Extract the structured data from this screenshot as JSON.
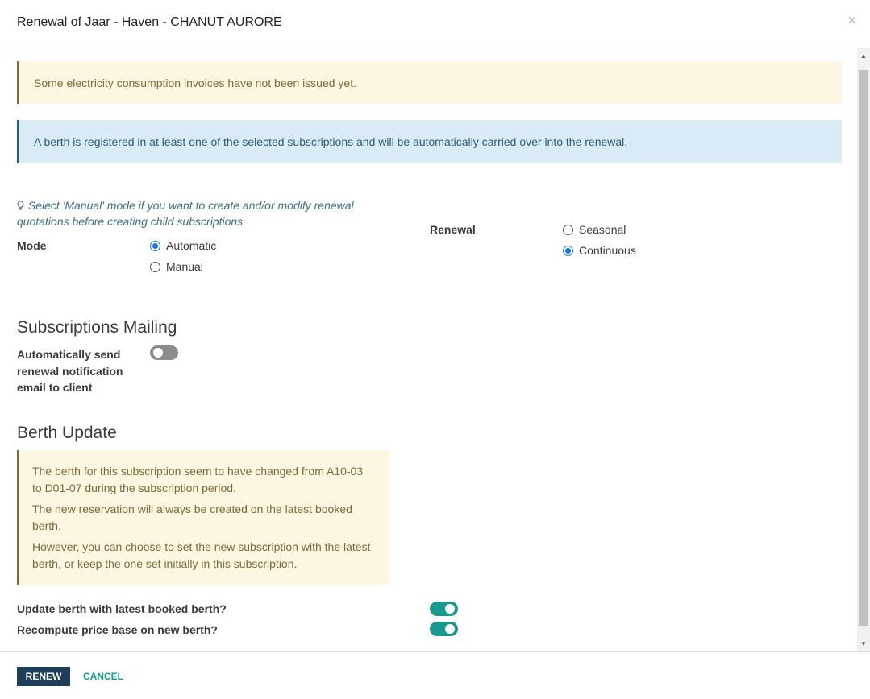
{
  "dialog": {
    "title": "Renewal of Jaar - Haven - CHANUT AURORE",
    "close_glyph": "×"
  },
  "alerts": {
    "warning": "Some electricity consumption invoices have not been issued yet.",
    "info": "A berth is registered in at least one of the selected subscriptions and will be automatically carried over into the renewal."
  },
  "hint": {
    "icon": "lightbulb-icon",
    "text": "Select 'Manual' mode if you want to create and/or modify renewal quotations before creating child subscriptions."
  },
  "mode": {
    "label": "Mode",
    "options": [
      {
        "label": "Automatic",
        "checked": true
      },
      {
        "label": "Manual",
        "checked": false
      }
    ]
  },
  "renewal": {
    "label": "Renewal",
    "options": [
      {
        "label": "Seasonal",
        "checked": false
      },
      {
        "label": "Continuous",
        "checked": true
      }
    ]
  },
  "mailing": {
    "title": "Subscriptions Mailing",
    "auto_send_label": "Automatically send renewal notification email to client",
    "auto_send_enabled": false
  },
  "berth_update": {
    "title": "Berth Update",
    "paragraphs": [
      "The berth for this subscription seem to have changed from A10-03 to D01-07 during the subscription period.",
      "The new reservation will always be created on the latest booked berth.",
      "However, you can choose to set the new subscription with the latest berth, or keep the one set initially in this subscription."
    ],
    "update_berth_label": "Update berth with latest booked berth?",
    "update_berth_enabled": true,
    "recompute_price_label": "Recompute price base on new berth?",
    "recompute_price_enabled": true
  },
  "footer": {
    "renew_label": "RENEW",
    "cancel_label": "CANCEL"
  },
  "colors": {
    "primary": "#1f3e5a",
    "accent": "#1a9a8c",
    "radio_checked": "#1a73e8",
    "warning_bg": "#fdf6e0",
    "info_bg": "#d9ecf5"
  }
}
